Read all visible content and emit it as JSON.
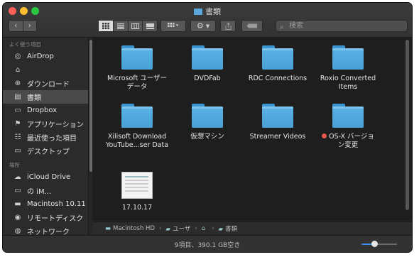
{
  "window": {
    "title": "書類"
  },
  "toolbar": {
    "back": "‹",
    "forward": "›",
    "arrange_icon": "grid-arrange-icon",
    "action_icon": "gear-icon",
    "search_placeholder": "検索"
  },
  "sidebar": {
    "sections": [
      {
        "title": "よく使う項目",
        "items": [
          {
            "label": "AirDrop",
            "icon": "airdrop-icon",
            "glyph": "◎",
            "selected": false
          },
          {
            "label": "",
            "icon": "home-icon",
            "glyph": "⌂",
            "selected": false
          },
          {
            "label": "ダウンロード",
            "icon": "download-icon",
            "glyph": "⊕",
            "selected": false
          },
          {
            "label": "書類",
            "icon": "documents-icon",
            "glyph": "▤",
            "selected": true
          },
          {
            "label": "Dropbox",
            "icon": "folder-icon",
            "glyph": "▭",
            "selected": false
          },
          {
            "label": "アプリケーション",
            "icon": "applications-icon",
            "glyph": "⚑",
            "selected": false
          },
          {
            "label": "最近使った項目",
            "icon": "recents-icon",
            "glyph": "☷",
            "selected": false
          },
          {
            "label": "デスクトップ",
            "icon": "desktop-icon",
            "glyph": "▭",
            "selected": false
          }
        ]
      },
      {
        "title": "場所",
        "items": [
          {
            "label": "iCloud Drive",
            "icon": "icloud-icon",
            "glyph": "☁",
            "selected": false
          },
          {
            "label": "の iM...",
            "icon": "computer-icon",
            "glyph": "▭",
            "selected": false
          },
          {
            "label": "Macintosh 10.11",
            "icon": "disk-icon",
            "glyph": "▬",
            "selected": false
          },
          {
            "label": "リモートディスク",
            "icon": "remote-disc-icon",
            "glyph": "◉",
            "selected": false
          },
          {
            "label": "ネットワーク",
            "icon": "network-icon",
            "glyph": "◍",
            "selected": false
          }
        ]
      }
    ]
  },
  "files": [
    {
      "name": "Microsoft ユーザー\nデータ",
      "type": "folder",
      "tag": false
    },
    {
      "name": "DVDFab",
      "type": "folder",
      "tag": false
    },
    {
      "name": "RDC Connections",
      "type": "folder",
      "tag": false
    },
    {
      "name": "Roxio Converted\nItems",
      "type": "folder",
      "tag": false
    },
    {
      "name": "Xilisoft Download\nYouTube...ser Data",
      "type": "folder",
      "tag": false
    },
    {
      "name": "仮想マシン",
      "type": "folder",
      "tag": false
    },
    {
      "name": "Streamer Videos",
      "type": "folder",
      "tag": false
    },
    {
      "name": "OS-X バージョ\nン変更",
      "type": "folder",
      "tag": true,
      "tag_color": "#e8534a"
    },
    {
      "name": "17.10.17",
      "type": "image",
      "tag": false
    }
  ],
  "pathbar": {
    "items": [
      {
        "label": "Macintosh HD",
        "icon": "disk-icon"
      },
      {
        "label": "ユーザ",
        "icon": "folder-icon"
      },
      {
        "label": "",
        "icon": "home-icon"
      },
      {
        "label": "書類",
        "icon": "folder-icon"
      }
    ]
  },
  "status": {
    "text": "9項目、390.1 GB空き"
  },
  "zoom_slider": {
    "value_fraction": 0.35
  }
}
